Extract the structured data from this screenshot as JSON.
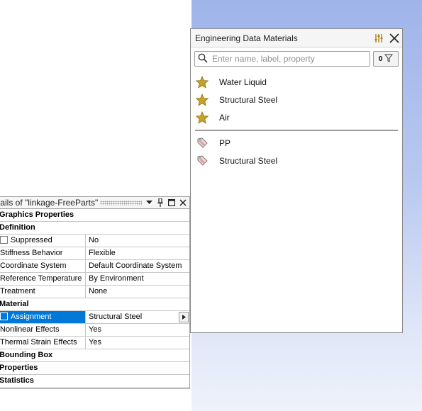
{
  "engineering_data": {
    "title": "Engineering Data Materials",
    "search_placeholder": "Enter name, label, property",
    "filter_count": "0",
    "favorites": [
      {
        "label": "Water Liquid",
        "icon": "star-icon"
      },
      {
        "label": "Structural Steel",
        "icon": "star-icon"
      },
      {
        "label": "Air",
        "icon": "star-icon"
      }
    ],
    "tagged": [
      {
        "label": "PP",
        "icon": "tag-icon"
      },
      {
        "label": "Structural Steel",
        "icon": "tag-icon"
      }
    ]
  },
  "details": {
    "title": "tails of \"linkage-FreeParts\"",
    "rows": [
      {
        "type": "section",
        "label": "Graphics Properties"
      },
      {
        "type": "section",
        "label": "Definition"
      },
      {
        "type": "prop",
        "label": "Suppressed",
        "value": "No",
        "checkbox": true
      },
      {
        "type": "prop",
        "label": "Stiffness Behavior",
        "value": "Flexible"
      },
      {
        "type": "prop",
        "label": "Coordinate System",
        "value": "Default Coordinate System"
      },
      {
        "type": "prop",
        "label": "Reference Temperature",
        "value": "By Environment"
      },
      {
        "type": "prop",
        "label": "Treatment",
        "value": "None"
      },
      {
        "type": "section",
        "label": "Material"
      },
      {
        "type": "prop",
        "label": "Assignment",
        "value": "Structural Steel",
        "checkbox": true,
        "selected": true,
        "dropdown": true
      },
      {
        "type": "prop",
        "label": "Nonlinear Effects",
        "value": "Yes"
      },
      {
        "type": "prop",
        "label": "Thermal Strain Effects",
        "value": "Yes"
      },
      {
        "type": "section",
        "label": "Bounding Box"
      },
      {
        "type": "section",
        "label": "Properties"
      },
      {
        "type": "section",
        "label": "Statistics"
      }
    ]
  },
  "colors": {
    "selection": "#0078d7",
    "star": "#c9a227",
    "viewport_top": "#9fb4ea"
  }
}
